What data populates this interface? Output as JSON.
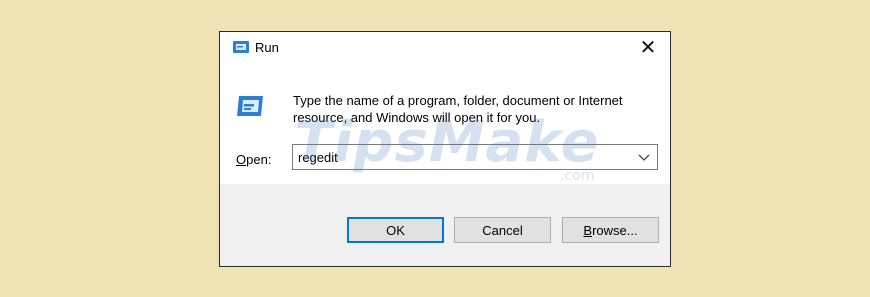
{
  "window": {
    "title": "Run",
    "close_glyph": "✕"
  },
  "content": {
    "description": "Type the name of a program, folder, document or Internet resource, and Windows will open it for you.",
    "open_label_mnemonic": "O",
    "open_label_rest": "pen:",
    "command_value": "regedit"
  },
  "buttons": {
    "ok": "OK",
    "cancel": "Cancel",
    "browse_mnemonic": "B",
    "browse_rest": "rowse..."
  },
  "watermark": {
    "text": "TipsMake",
    "suffix": ".com"
  },
  "icons": {
    "title": "run-icon",
    "big": "run-icon",
    "dropdown": "chevron-down-icon",
    "close": "close-icon"
  },
  "colors": {
    "background": "#efe2b4",
    "accent": "#0078d7",
    "footer": "#f0f0f0"
  }
}
